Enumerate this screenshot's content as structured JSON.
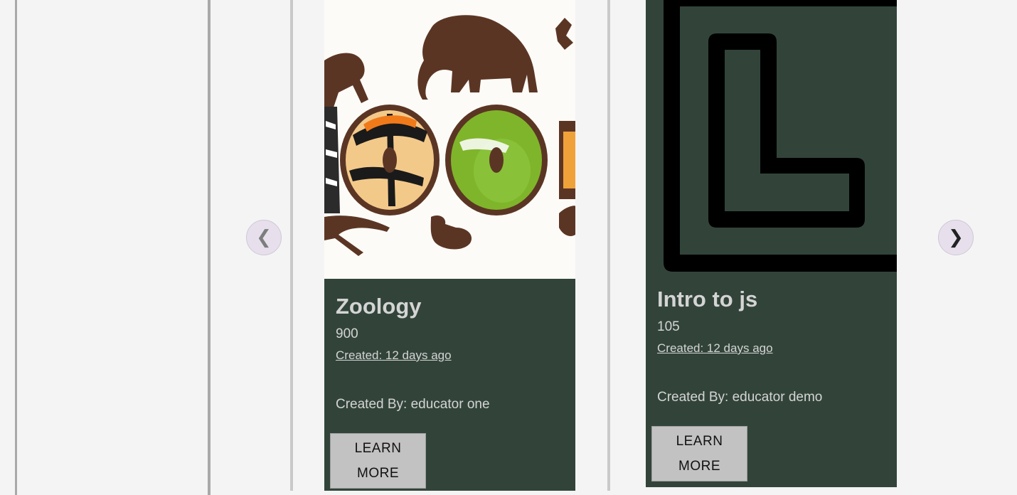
{
  "carousel": {
    "prev_glyph": "❮",
    "next_glyph": "❯"
  },
  "cards": [
    {
      "title": "Zoology",
      "number": "900",
      "created": "Created: 12 days ago",
      "author": "Created By: educator one",
      "button_line1": "LEARN",
      "button_line2": "MORE",
      "image": "zoology-animals-illustration"
    },
    {
      "title": "Intro to js",
      "number": "105",
      "created": "Created: 12 days ago",
      "author": "Created By: educator demo",
      "button_line1": "LEARN",
      "button_line2": "MORE",
      "image": "letter-l-logo"
    }
  ],
  "colors": {
    "page_bg": "#f4f4f4",
    "card_bg": "#32443a",
    "button_bg": "#c2c2c2",
    "nav_button_bg": "#e7e0ec"
  }
}
